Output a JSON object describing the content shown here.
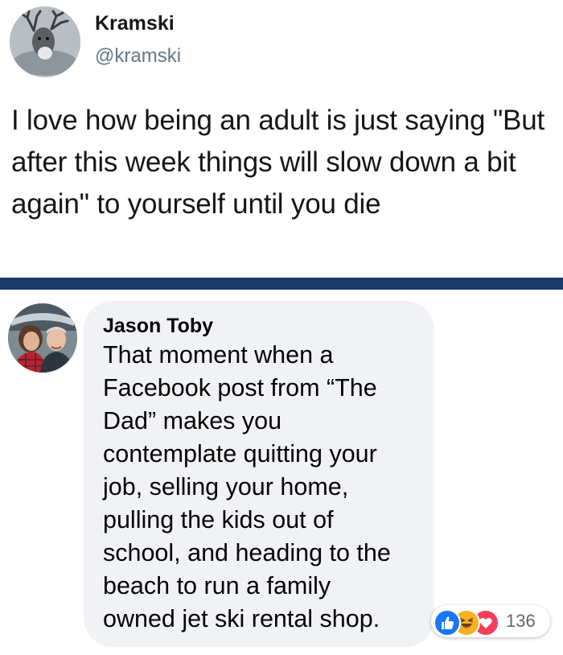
{
  "tweet": {
    "display_name": "Kramski",
    "handle": "@kramski",
    "avatar_icon": "reindeer-profile-photo",
    "text": "I love how being an adult is just saying \"But after this week things will slow down a bit again\" to yourself until you die"
  },
  "divider_color": "#1c3a6b",
  "comment": {
    "author": "Jason Toby",
    "avatar_icon": "couple-profile-photo",
    "text": "That moment when a\nFacebook post from “The\nDad” makes you\ncontemplate quitting your\njob, selling your home,\npulling the kids out of\nschool, and heading to the\nbeach to run a family\nowned  jet ski rental shop.",
    "bubble_color": "#f0f2f5",
    "reactions": {
      "icons": [
        "like-icon",
        "haha-icon",
        "love-icon"
      ],
      "count": "136"
    }
  }
}
